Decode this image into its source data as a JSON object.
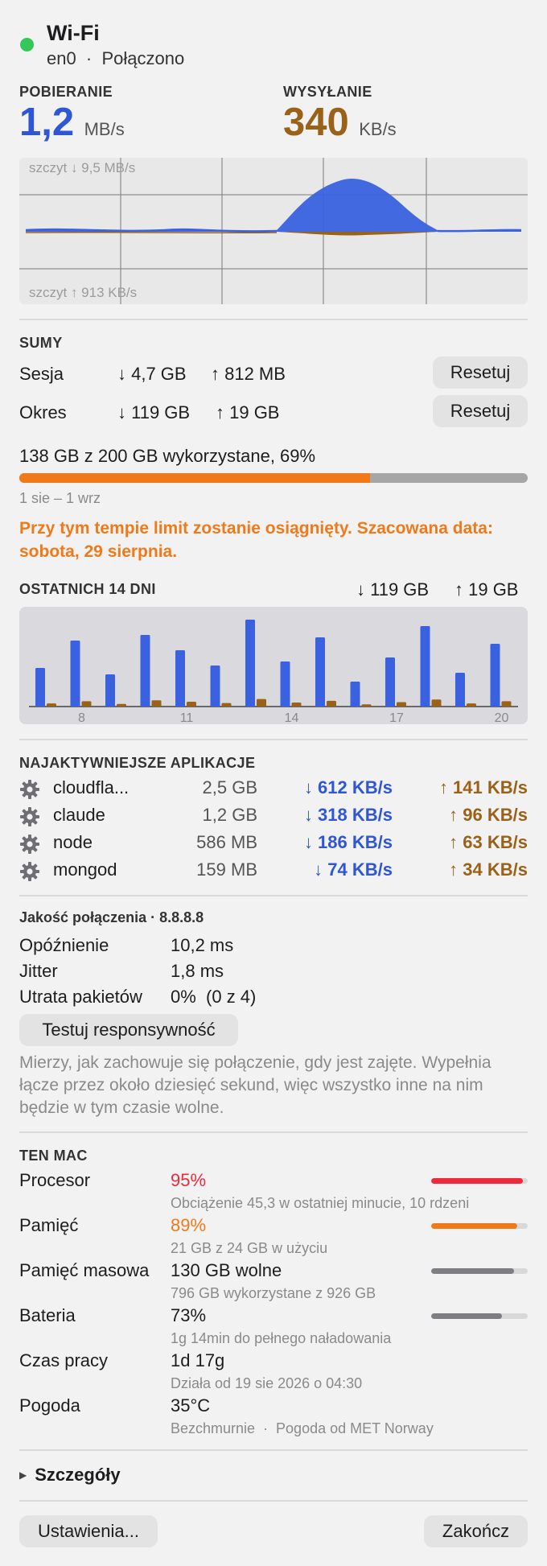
{
  "header": {
    "status_color": "#34c759",
    "title": "Wi-Fi",
    "subtitle": "en0  ·  Połączono"
  },
  "speeds": {
    "download_label": "POBIERANIE",
    "download_value": "1,2",
    "download_unit": "MB/s",
    "upload_label": "WYSYŁANIE",
    "upload_value": "340",
    "upload_unit": "KB/s"
  },
  "graph": {
    "peak_down": "szczyt ↓ 9,5 MB/s",
    "peak_up": "szczyt ↑ 913 KB/s",
    "download_color": "#3a62e0",
    "upload_color": "#9a6218"
  },
  "totals": {
    "title": "SUMY",
    "rows": [
      {
        "label": "Sesja",
        "down": "↓ 4,7 GB",
        "up": "↑ 812 MB",
        "button": "Resetuj"
      },
      {
        "label": "Okres",
        "down": "↓ 119 GB",
        "up": "↑ 19 GB",
        "button": "Resetuj"
      }
    ]
  },
  "usage": {
    "summary": "138 GB z 200 GB wykorzystane, 69%",
    "percent": 69,
    "range": "1 sie – 1 wrz",
    "warning": "Przy tym tempie limit zostanie osiągnięty. Szacowana data: sobota, 29 sierpnia."
  },
  "history": {
    "title": "OSTATNICH 14 DNI",
    "total_down": "↓ 119 GB",
    "total_up": "↑ 19 GB",
    "tick_labels": [
      "8",
      "11",
      "14",
      "17",
      "20"
    ],
    "chart_data": {
      "type": "bar",
      "categories": [
        "7",
        "8",
        "9",
        "10",
        "11",
        "12",
        "13",
        "14",
        "15",
        "16",
        "17",
        "18",
        "19",
        "20"
      ],
      "series": [
        {
          "values": [
            48,
            82,
            40,
            89,
            70,
            51,
            108,
            56,
            86,
            31,
            61,
            100,
            42,
            78
          ]
        },
        {
          "values": [
            7,
            12,
            6,
            14,
            11,
            8,
            17,
            9,
            13,
            5,
            10,
            16,
            7,
            12
          ]
        }
      ]
    }
  },
  "apps": {
    "title": "NAJAKTYWNIEJSZE APLIKACJE",
    "items": [
      {
        "name": "cloudfla...",
        "total": "2,5 GB",
        "down": "↓ 612 KB/s",
        "up": "↑ 141 KB/s"
      },
      {
        "name": "claude",
        "total": "1,2 GB",
        "down": "↓ 318 KB/s",
        "up": "↑ 96 KB/s"
      },
      {
        "name": "node",
        "total": "586 MB",
        "down": "↓ 186 KB/s",
        "up": "↑ 63 KB/s"
      },
      {
        "name": "mongod",
        "total": "159 MB",
        "down": "↓ 74 KB/s",
        "up": "↑ 34 KB/s"
      }
    ]
  },
  "quality": {
    "title": "Jakość połączenia · 8.8.8.8",
    "rows": [
      {
        "label": "Opóźnienie",
        "value": "10,2 ms"
      },
      {
        "label": "Jitter",
        "value": "1,8 ms"
      },
      {
        "label": "Utrata pakietów",
        "value": "0%  (0 z 4)"
      }
    ],
    "button": "Testuj responsywność",
    "description": "Mierzy, jak zachowuje się połączenie, gdy jest zajęte. Wypełnia łącze przez około dziesięć sekund, więc wszystko inne na nim będzie w tym czasie wolne."
  },
  "mac": {
    "title": "TEN MAC",
    "rows": [
      {
        "label": "Procesor",
        "value": "95%",
        "detail": "Obciążenie 45,3 w ostatniej minucie, 10 rdzeni",
        "level": 0.95,
        "color": "#f0283c"
      },
      {
        "label": "Pamięć",
        "value": "89%",
        "detail": "21 GB z 24 GB w użyciu",
        "level": 0.89,
        "color": "#f07a1a"
      },
      {
        "label": "Pamięć masowa",
        "value": "130 GB wolne",
        "detail": "796 GB wykorzystane z 926 GB",
        "level": 0.86,
        "color": "#7d7d82"
      },
      {
        "label": "Bateria",
        "value": "73%",
        "detail": "1g 14min do pełnego naładowania",
        "level": 0.73,
        "color": "#7d7d82"
      },
      {
        "label": "Czas pracy",
        "value": "1d 17g",
        "detail": "Działa od 19 sie 2026 o 04:30"
      },
      {
        "label": "Pogoda",
        "value": "35°C",
        "detail": "Bezchmurnie  ·  Pogoda od MET Norway"
      }
    ]
  },
  "details": {
    "label": "Szczegóły"
  },
  "footer": {
    "settings": "Ustawienia...",
    "quit": "Zakończ"
  }
}
